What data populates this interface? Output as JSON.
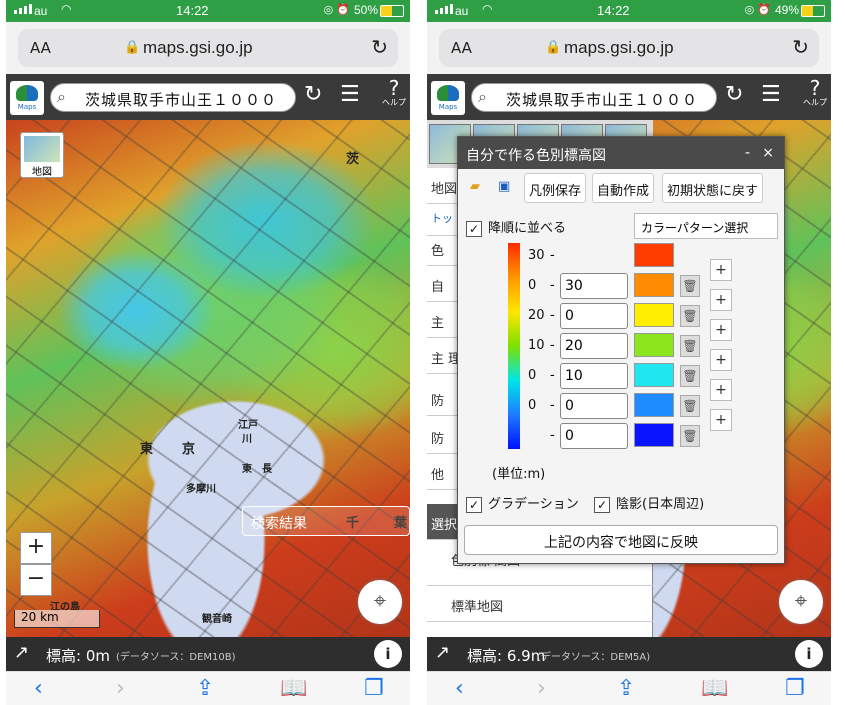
{
  "left": {
    "status": {
      "carrier": "au",
      "time": "14:22",
      "battery": "50%",
      "battery_fill": 0.5
    },
    "url": "maps.gsi.go.jp",
    "aa": "AA",
    "search_text": "茨城県取手市山王１０００",
    "help_label": "ヘルプ",
    "layer_label": "地図",
    "zoom_in": "+",
    "zoom_out": "−",
    "scale": "20 km",
    "search_result": "検索結果",
    "elevation_label": "標高:",
    "elevation_value": "0m",
    "data_source": "(データソース：DEM10B)",
    "info": "i",
    "map_labels": [
      "茨",
      "東",
      "京",
      "江戸",
      "川",
      "東",
      "長",
      "多摩川",
      "千",
      "葉",
      "江の島",
      "観音崎"
    ]
  },
  "right": {
    "status": {
      "carrier": "au",
      "time": "14:22",
      "battery": "49%",
      "battery_fill": 0.49
    },
    "url": "maps.gsi.go.jp",
    "aa": "AA",
    "search_text": "茨城県取手市山王１０００",
    "help_label": "ヘルプ",
    "side_panel": {
      "rows": [
        "地図",
        "トッ",
        "色",
        "自",
        "主",
        "主\n理",
        "防",
        "防",
        "他"
      ],
      "select_header": "選択",
      "layer1": "色別標\n高図",
      "layer2": "標準地図"
    },
    "dialog": {
      "title": "自分で作る色別標高図",
      "minimize": "-",
      "close": "×",
      "save_legend": "凡例保存",
      "auto_create": "自動作成",
      "reset": "初期状態に戻す",
      "sort_desc": "降順に並べる",
      "color_pattern": "カラーパターン選択",
      "levels": [
        {
          "label": "30",
          "value": "",
          "color": "#ff3c00"
        },
        {
          "label": "0",
          "value": "30",
          "color": "#ff8c00"
        },
        {
          "label": "20",
          "value": "0",
          "color": "#ffee00"
        },
        {
          "label": "10",
          "value": "20",
          "color": "#8ce61e"
        },
        {
          "label": "0",
          "value": "10",
          "color": "#20e6f0"
        },
        {
          "label": "0",
          "value": "0",
          "color": "#1e8cff"
        },
        {
          "label": "",
          "value": "0",
          "color": "#0a14ff"
        }
      ],
      "unit": "(単位:m)",
      "gradation": "グラデーション",
      "shade": "陰影(日本周辺)",
      "apply": "上記の内容で地図に反映"
    },
    "elevation_label": "標高:",
    "elevation_value": "6.9m",
    "data_source": "(データソース：DEM5A)",
    "info": "i"
  }
}
